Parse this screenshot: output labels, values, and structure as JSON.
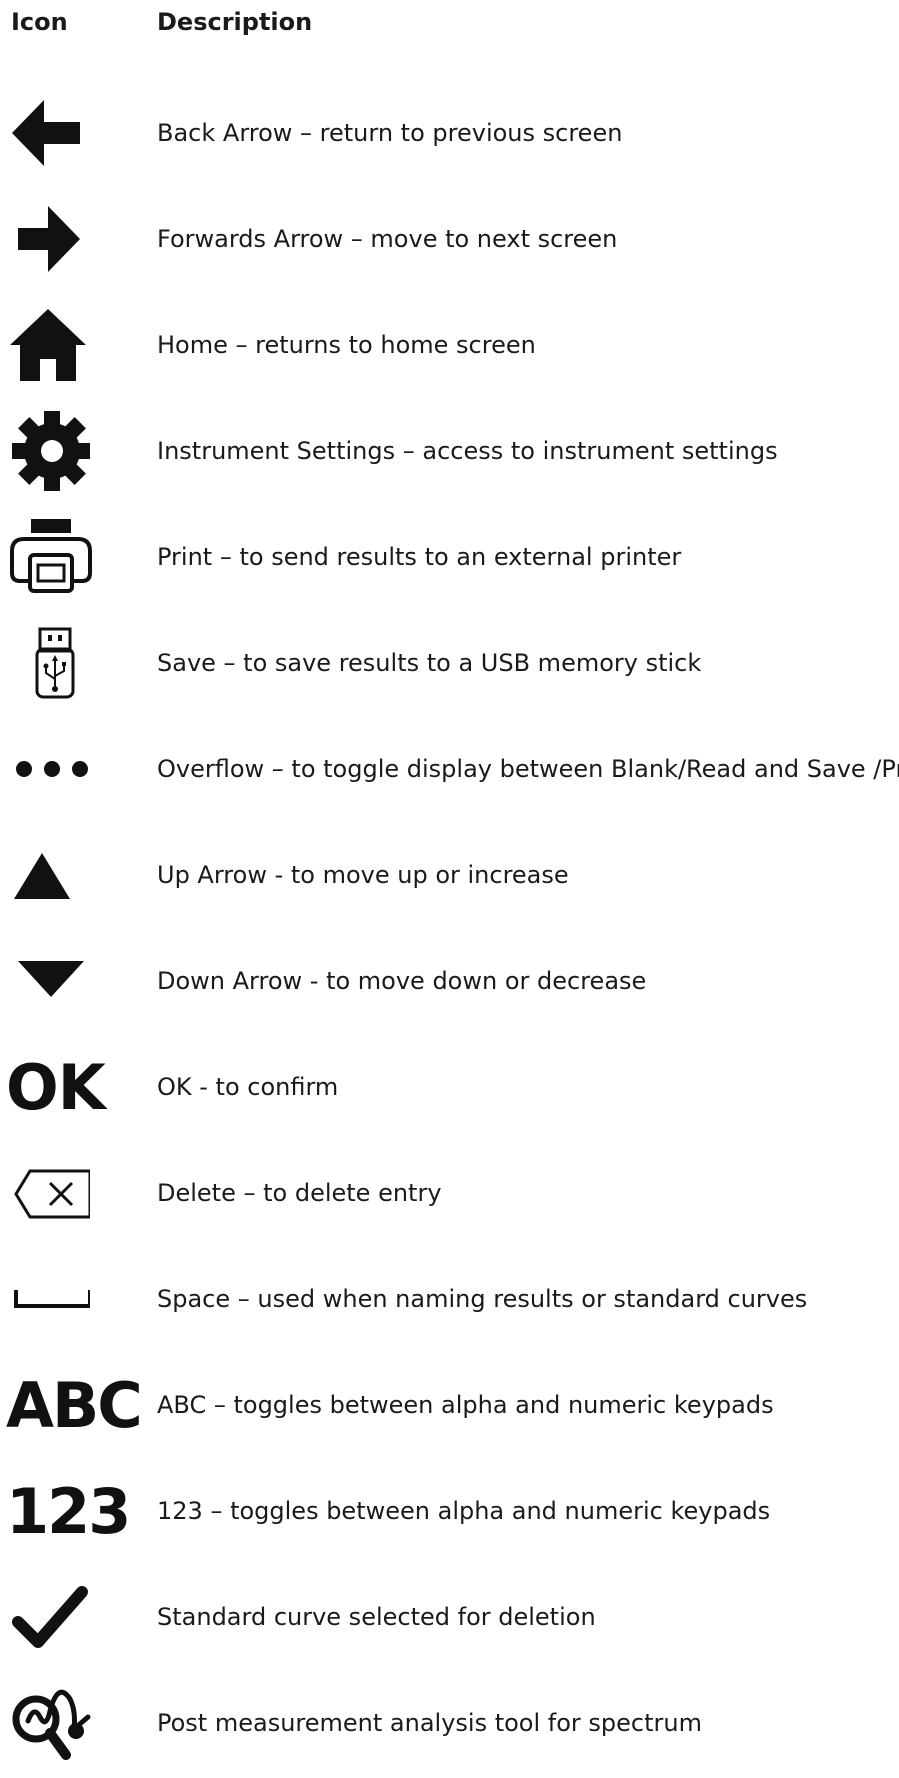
{
  "header": {
    "icon": "Icon",
    "description": "Description"
  },
  "rows": [
    {
      "icon": "back-arrow-icon",
      "description": "Back Arrow – return to previous screen"
    },
    {
      "icon": "forward-arrow-icon",
      "description": "Forwards Arrow – move to next screen"
    },
    {
      "icon": "home-icon",
      "description": "Home – returns to home screen"
    },
    {
      "icon": "gear-icon",
      "description": "Instrument Settings – access to instrument settings"
    },
    {
      "icon": "printer-icon",
      "description": "Print – to send results to an external printer"
    },
    {
      "icon": "usb-stick-icon",
      "description": "Save – to save results to a USB memory stick"
    },
    {
      "icon": "overflow-icon",
      "description": "Overflow – to toggle display between Blank/Read and Save /Print"
    },
    {
      "icon": "up-triangle-icon",
      "description": "Up Arrow - to move up or increase"
    },
    {
      "icon": "down-triangle-icon",
      "description": "Down Arrow - to move down or decrease"
    },
    {
      "icon": "ok-icon",
      "icon_text": "OK",
      "description": "OK - to confirm"
    },
    {
      "icon": "delete-icon",
      "description": "Delete – to delete entry"
    },
    {
      "icon": "space-icon",
      "description": "Space – used when naming results or standard curves"
    },
    {
      "icon": "abc-icon",
      "icon_text": "ABC",
      "description": "ABC – toggles between alpha and numeric keypads"
    },
    {
      "icon": "numeric-icon",
      "icon_text": "123",
      "description": "123 – toggles between alpha and numeric keypads"
    },
    {
      "icon": "checkmark-icon",
      "description": "Standard curve selected for deletion"
    },
    {
      "icon": "analysis-tool-icon",
      "description": "Post measurement analysis tool for spectrum"
    }
  ]
}
